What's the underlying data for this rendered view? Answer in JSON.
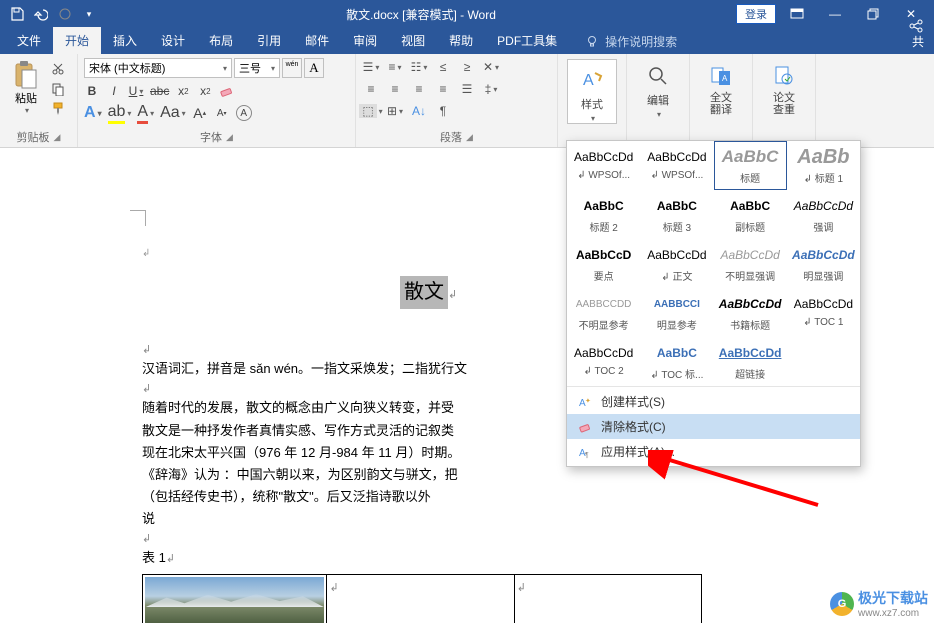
{
  "title": "散文.docx [兼容模式] - Word",
  "login": "登录",
  "tabs": {
    "file": "文件",
    "home": "开始",
    "insert": "插入",
    "design": "设计",
    "layout": "布局",
    "references": "引用",
    "mailings": "邮件",
    "review": "审阅",
    "view": "视图",
    "help": "帮助",
    "pdf": "PDF工具集"
  },
  "tellme": "操作说明搜索",
  "clipboard": {
    "paste": "粘贴",
    "label": "剪贴板"
  },
  "font": {
    "name": "宋体 (中文标题)",
    "size": "三号",
    "label": "字体"
  },
  "para": {
    "label": "段落"
  },
  "styles_btn": "样式",
  "edit_btn": "编辑",
  "translate_btn": "全文\n翻译",
  "check_btn": "论文\n查重",
  "styles_gallery": [
    {
      "p": "AaBbCcDd",
      "n": "↲ WPSOf...",
      "cls": ""
    },
    {
      "p": "AaBbCcDd",
      "n": "↲ WPSOf...",
      "cls": ""
    },
    {
      "p": "AaBbC",
      "n": "标题",
      "cls": "sel big"
    },
    {
      "p": "AaBb",
      "n": "↲ 标题 1",
      "cls": "bigger"
    },
    {
      "p": "AaBbC",
      "n": "标题 2",
      "cls": "b"
    },
    {
      "p": "AaBbC",
      "n": "标题 3",
      "cls": "b"
    },
    {
      "p": "AaBbC",
      "n": "副标题",
      "cls": "b"
    },
    {
      "p": "AaBbCcDd",
      "n": "强调",
      "cls": "i"
    },
    {
      "p": "AaBbCcD",
      "n": "要点",
      "cls": "b"
    },
    {
      "p": "AaBbCcDd",
      "n": "↲ 正文",
      "cls": ""
    },
    {
      "p": "AaBbCcDd",
      "n": "不明显强调",
      "cls": "i g"
    },
    {
      "p": "AaBbCcDd",
      "n": "明显强调",
      "cls": "i bl"
    },
    {
      "p": "AABBCCDD",
      "n": "不明显参考",
      "cls": "g sm"
    },
    {
      "p": "AABBCCI",
      "n": "明显参考",
      "cls": "bl b sm"
    },
    {
      "p": "AaBbCcDd",
      "n": "书籍标题",
      "cls": "b i"
    },
    {
      "p": "AaBbCcDd",
      "n": "↲ TOC 1",
      "cls": ""
    },
    {
      "p": "AaBbCcDd",
      "n": "↲ TOC 2",
      "cls": ""
    },
    {
      "p": "AaBbC",
      "n": "↲ TOC 标...",
      "cls": "bl"
    },
    {
      "p": "AaBbCcDd",
      "n": "超链接",
      "cls": "u bl"
    }
  ],
  "styles_menu": {
    "create": "创建样式(S)",
    "clear": "清除格式(C)",
    "apply": "应用样式(A)..."
  },
  "doc": {
    "title": "散文",
    "p1": "汉语词汇，拼音是 sǎn wén。一指文采焕发；二指犹行文",
    "p2": "随着时代的发展，散文的概念由广义向狭义转变，并受",
    "p3": "散文是一种抒发作者真情实感、写作方式灵活的记叙类",
    "p4": "现在北宋太平兴国（976 年 12 月-984 年 11 月）时期。",
    "p5": "《辞海》认为 ：中国六朝以来，为区别韵文与骈文，把",
    "p6": "（包括经传史书），统称\"散文\"。后又泛指诗歌以外",
    "p7": "说",
    "tbl": "表 1"
  },
  "wm": {
    "name": "极光下载站",
    "url": "www.xz7.com"
  }
}
